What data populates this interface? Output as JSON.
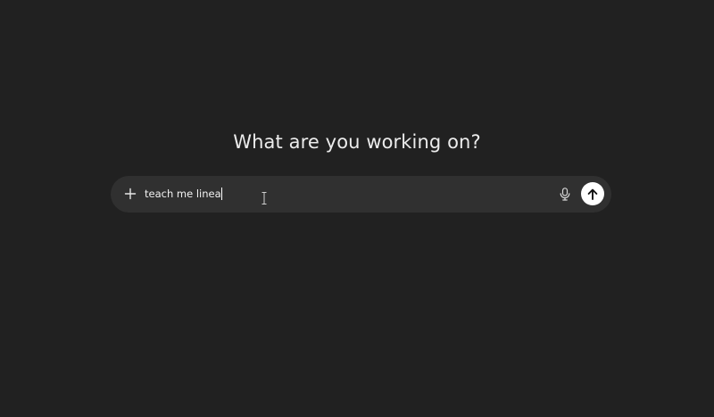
{
  "heading": "What are you working on?",
  "composer": {
    "input_value": "teach me linea",
    "icons": {
      "add": "plus-icon",
      "voice": "microphone-icon",
      "send": "arrow-up-icon"
    }
  },
  "colors": {
    "background": "#212121",
    "composer_background": "#303030",
    "text": "#ececec",
    "send_button": "#ffffff"
  }
}
